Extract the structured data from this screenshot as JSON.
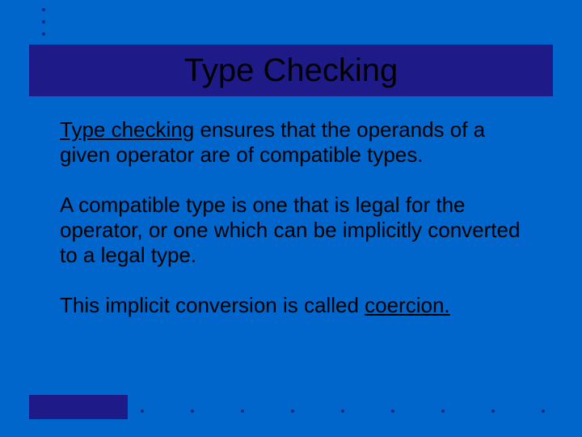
{
  "title": "Type Checking",
  "body": {
    "p1_lead": "Type checking",
    "p1_rest": " ensures that the operands of a given operator are of compatible types.",
    "p2": "A compatible type is one that is legal for the operator, or one which can be implicitly converted to a legal type.",
    "p3_lead": "This implicit conversion is called ",
    "p3_underlined": "coercion."
  }
}
